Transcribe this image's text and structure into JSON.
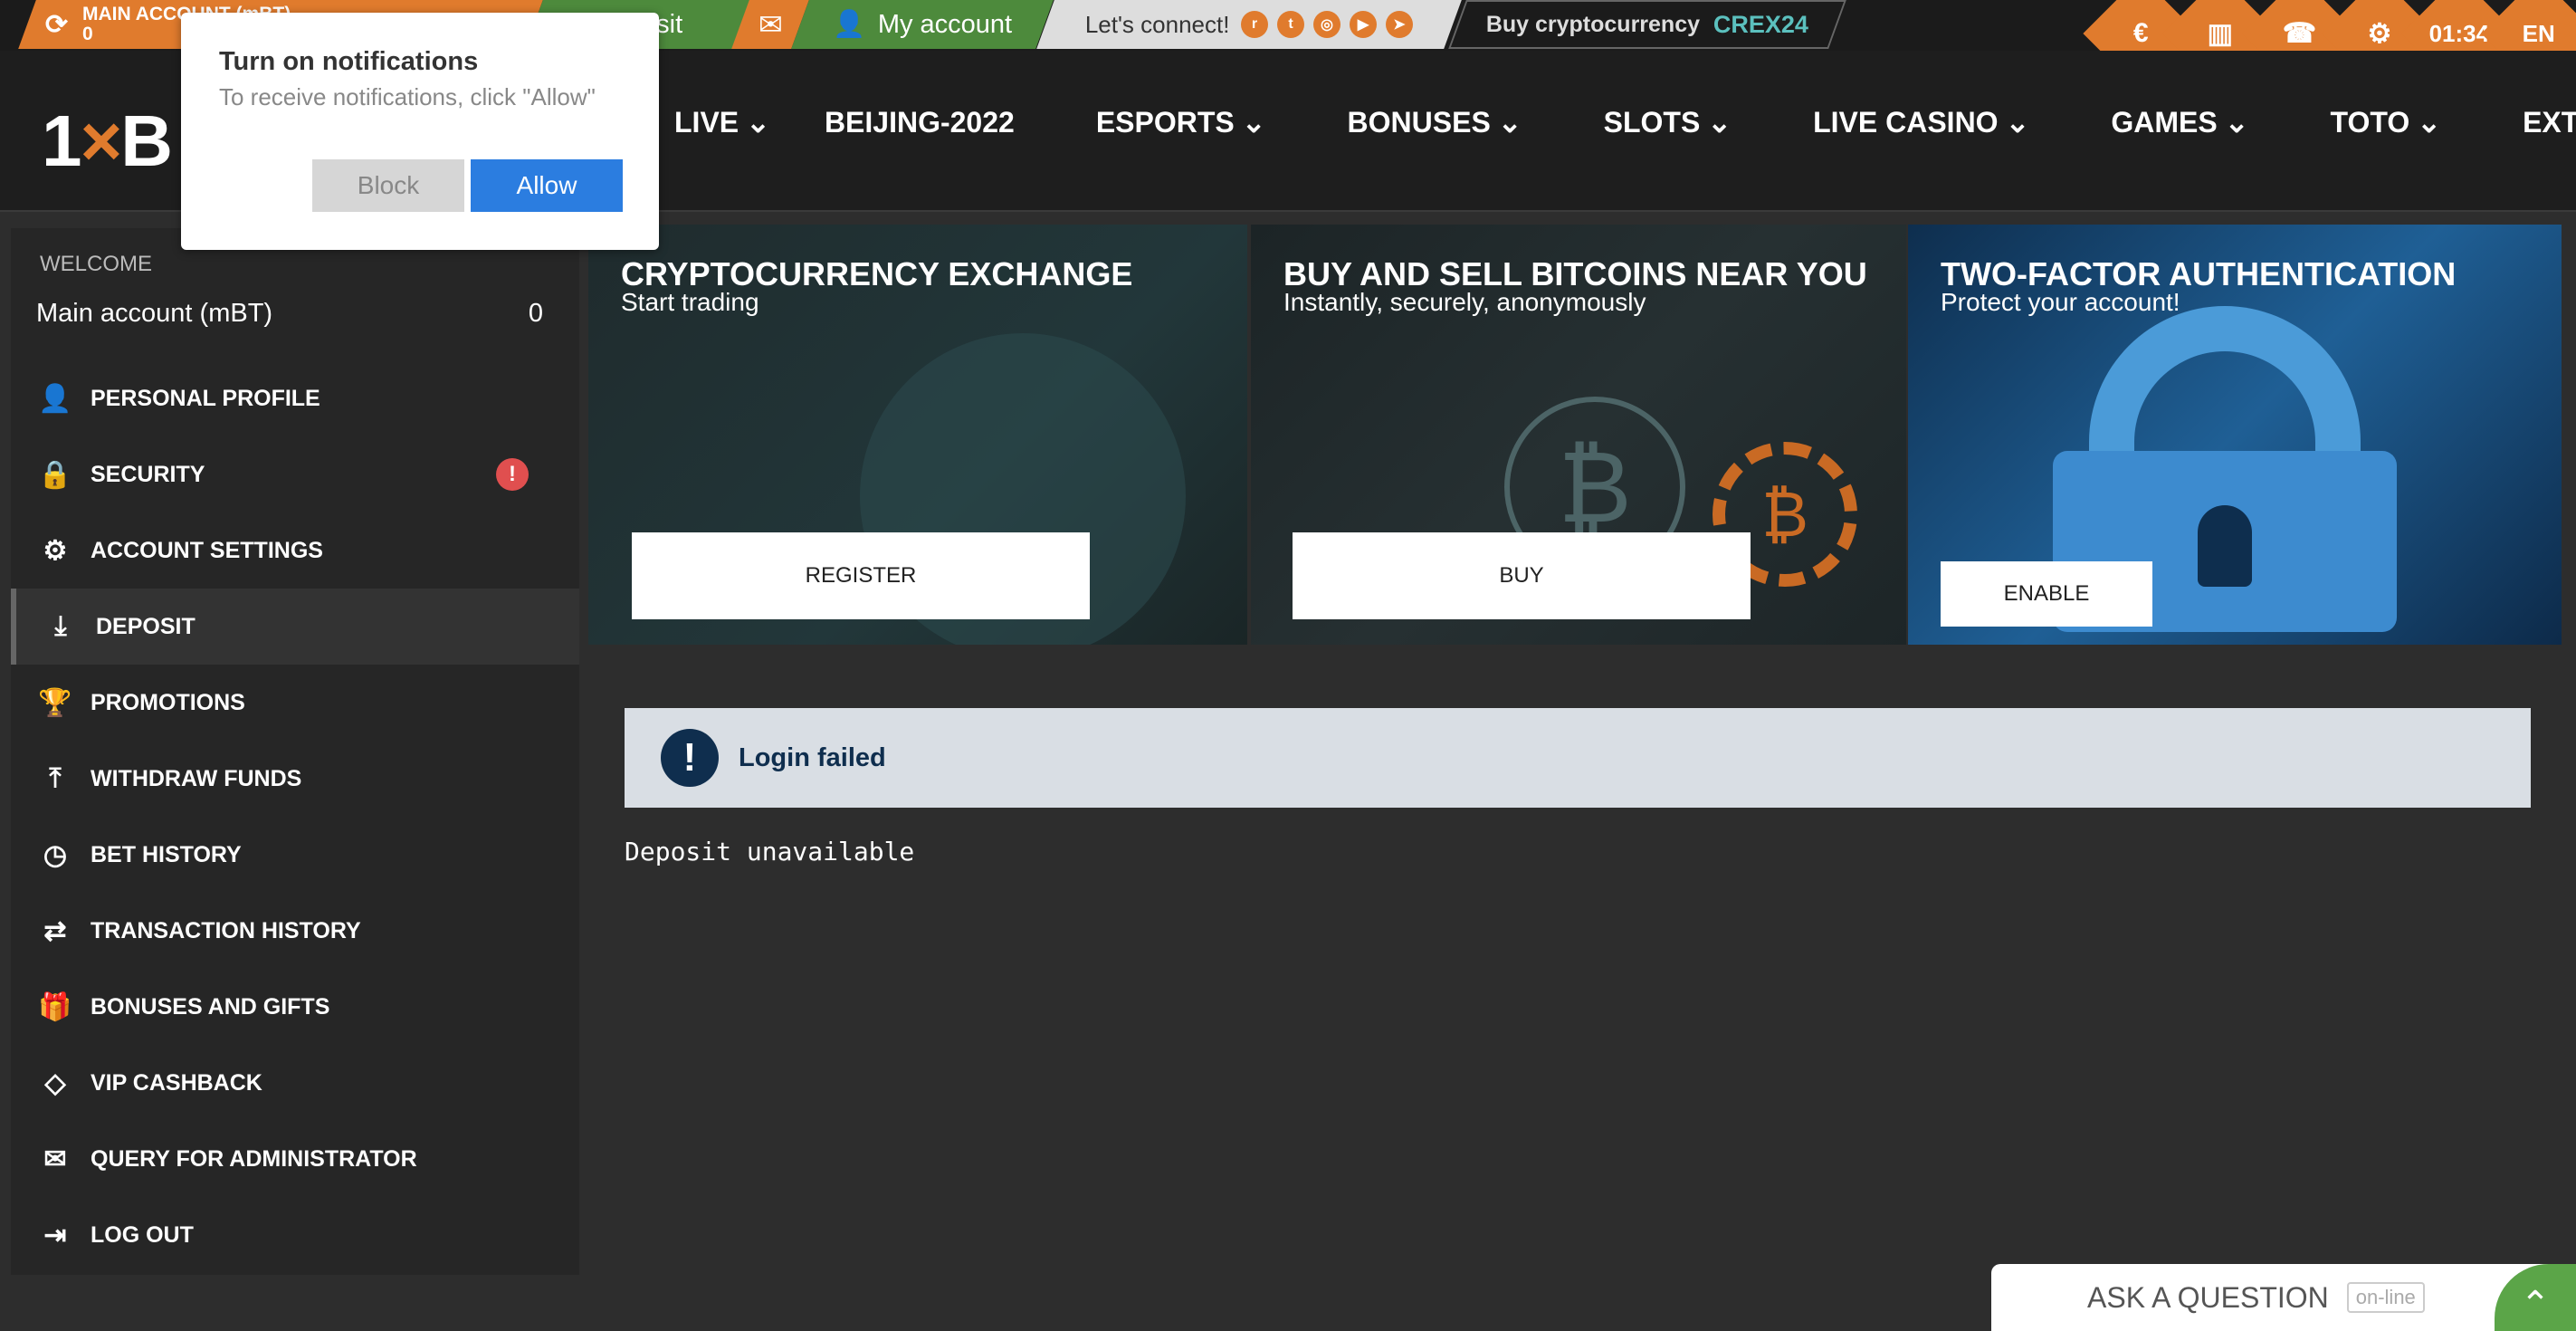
{
  "topbar": {
    "account_label": "MAIN ACCOUNT (mBT)",
    "account_balance": "0",
    "deposit_label": "Deposit",
    "my_account_label": "My account",
    "connect_label": "Let's connect!",
    "buy_crypto_label": "Buy cryptocurrency",
    "crex_label": "CREX24",
    "time": "01:34",
    "language": "EN",
    "accent_color": "#e07b2d",
    "green_color": "#4d8a3c"
  },
  "nav": {
    "logo_1": "1",
    "logo_x": "×",
    "logo_b": "B",
    "items": [
      "LIVE",
      "BEIJING-2022",
      "ESPORTS",
      "BONUSES",
      "SLOTS",
      "LIVE CASINO",
      "GAMES",
      "TOTO",
      "EXTRA"
    ]
  },
  "notification": {
    "title": "Turn on notifications",
    "text": "To receive notifications, click \"Allow\"",
    "block_label": "Block",
    "allow_label": "Allow"
  },
  "sidebar": {
    "welcome": "WELCOME",
    "account_name": "Main account (mBT)",
    "account_balance": "0",
    "items": [
      {
        "label": "PERSONAL PROFILE",
        "icon": "user-plus-icon"
      },
      {
        "label": "SECURITY",
        "icon": "lock-icon"
      },
      {
        "label": "ACCOUNT SETTINGS",
        "icon": "gears-icon"
      },
      {
        "label": "DEPOSIT",
        "icon": "download-icon"
      },
      {
        "label": "PROMOTIONS",
        "icon": "trophy-icon"
      },
      {
        "label": "WITHDRAW FUNDS",
        "icon": "upload-icon"
      },
      {
        "label": "BET HISTORY",
        "icon": "clock-icon"
      },
      {
        "label": "TRANSACTION HISTORY",
        "icon": "arrows-icon"
      },
      {
        "label": "BONUSES AND GIFTS",
        "icon": "gift-hand-icon"
      },
      {
        "label": "VIP CASHBACK",
        "icon": "diamond-icon"
      },
      {
        "label": "QUERY FOR ADMINISTRATOR",
        "icon": "envelope-icon"
      },
      {
        "label": "LOG OUT",
        "icon": "logout-icon"
      }
    ],
    "security_alert": "!"
  },
  "banners": [
    {
      "title": "CRYPTOCURRENCY EXCHANGE",
      "subtitle": "Start trading",
      "button": "REGISTER"
    },
    {
      "title": "BUY AND SELL BITCOINS NEAR YOU",
      "subtitle": "Instantly, securely, anonymously",
      "button": "BUY"
    },
    {
      "title": "TWO-FACTOR AUTHENTICATION",
      "subtitle": "Protect your account!",
      "button": "ENABLE"
    }
  ],
  "message": {
    "icon": "!",
    "text": "Login failed",
    "detail": "Deposit unavailable"
  },
  "chat": {
    "label": "ASK A QUESTION",
    "status": "on-line"
  }
}
